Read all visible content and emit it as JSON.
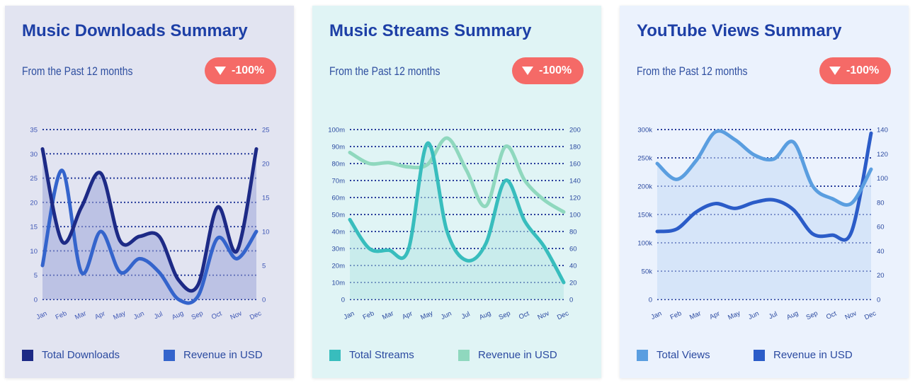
{
  "cards": [
    {
      "title": "Music Downloads Summary",
      "subtitle": "From the Past 12 months",
      "badge": "-100%",
      "background": "#e2e4f1",
      "chart_data": {
        "type": "line",
        "categories": [
          "Jan",
          "Feb",
          "Mar",
          "Apr",
          "May",
          "Jun",
          "Jul",
          "Aug",
          "Sep",
          "Oct",
          "Nov",
          "Dec"
        ],
        "series": [
          {
            "name": "Total Downloads",
            "axis": "left",
            "color": "#1d2a86",
            "filled": true,
            "values": [
              31,
              12,
              19,
              26,
              12,
              13,
              13,
              4,
              3,
              19,
              10,
              31
            ]
          },
          {
            "name": "Revenue in USD",
            "axis": "right",
            "color": "#3464cc",
            "filled": false,
            "values": [
              5,
              19,
              4,
              10,
              4,
              6,
              4,
              0,
              0.5,
              9,
              6,
              10
            ]
          }
        ],
        "y_left": {
          "min": 0,
          "max": 35,
          "ticks": [
            "0",
            "5",
            "10",
            "15",
            "20",
            "25",
            "30",
            "35"
          ]
        },
        "y_right": {
          "min": 0,
          "max": 25,
          "ticks": [
            "0",
            "5",
            "10",
            "15",
            "20",
            "25"
          ]
        },
        "grid": true,
        "legend_position": "bottom",
        "tick_color": "#3f57b5",
        "grid_color": "#263b9a",
        "fill_color": "#9ca6d8"
      }
    },
    {
      "title": "Music Streams Summary",
      "subtitle": "From the Past 12 months",
      "badge": "-100%",
      "background": "#e0f4f5",
      "chart_data": {
        "type": "line",
        "categories": [
          "Jan",
          "Feb",
          "Mar",
          "Apr",
          "May",
          "Jun",
          "Jul",
          "Aug",
          "Sep",
          "Oct",
          "Nov",
          "Dec"
        ],
        "series": [
          {
            "name": "Total Streams",
            "axis": "left",
            "color": "#38bdbd",
            "filled": true,
            "values": [
              47,
              30,
              29,
              29,
              92,
              40,
              23,
              33,
              70,
              46,
              31,
              10
            ]
          },
          {
            "name": "Revenue in USD",
            "axis": "right",
            "color": "#8fd8be",
            "filled": false,
            "values": [
              173,
              160,
              161,
              156,
              159,
              190,
              152,
              110,
              180,
              140,
              117,
              103
            ]
          }
        ],
        "y_left": {
          "min": 0,
          "max": 100,
          "ticks": [
            "0",
            "10m",
            "20m",
            "30m",
            "40m",
            "50m",
            "60m",
            "70m",
            "80m",
            "90m",
            "100m"
          ]
        },
        "y_right": {
          "min": 0,
          "max": 200,
          "ticks": [
            "0",
            "20",
            "40",
            "60",
            "80",
            "100",
            "120",
            "140",
            "160",
            "180",
            "200"
          ]
        },
        "grid": true,
        "legend_position": "bottom",
        "tick_color": "#2b4aa0",
        "grid_color": "#263b9a",
        "fill_color": "#b6e6e4"
      }
    },
    {
      "title": "YouTube Views Summary",
      "subtitle": "From the Past 12 months",
      "badge": "-100%",
      "background": "#ebf2fd",
      "chart_data": {
        "type": "line",
        "categories": [
          "Jan",
          "Feb",
          "Mar",
          "Apr",
          "May",
          "Jun",
          "Jul",
          "Aug",
          "Sep",
          "Oct",
          "Nov",
          "Dec"
        ],
        "series": [
          {
            "name": "Total Views",
            "axis": "left",
            "color": "#5a9ee0",
            "filled": true,
            "values": [
              240000,
              212000,
              245000,
              296000,
              282000,
              255000,
              248000,
              278000,
              200000,
              178000,
              170000,
              230000
            ]
          },
          {
            "name": "Revenue in USD",
            "axis": "right",
            "color": "#2b5cc8",
            "filled": false,
            "values": [
              56,
              58,
              72,
              79,
              75,
              80,
              82,
              74,
              54,
              53,
              56,
              137
            ]
          }
        ],
        "y_left": {
          "min": 0,
          "max": 300000,
          "ticks": [
            "0",
            "50k",
            "100k",
            "150k",
            "200k",
            "250k",
            "300k"
          ]
        },
        "y_right": {
          "min": 0,
          "max": 140,
          "ticks": [
            "0",
            "20",
            "40",
            "60",
            "80",
            "100",
            "120",
            "140"
          ]
        },
        "grid": true,
        "legend_position": "bottom",
        "tick_color": "#2b4aa0",
        "grid_color": "#263b9a",
        "fill_color": "#c4dbf6"
      }
    }
  ]
}
